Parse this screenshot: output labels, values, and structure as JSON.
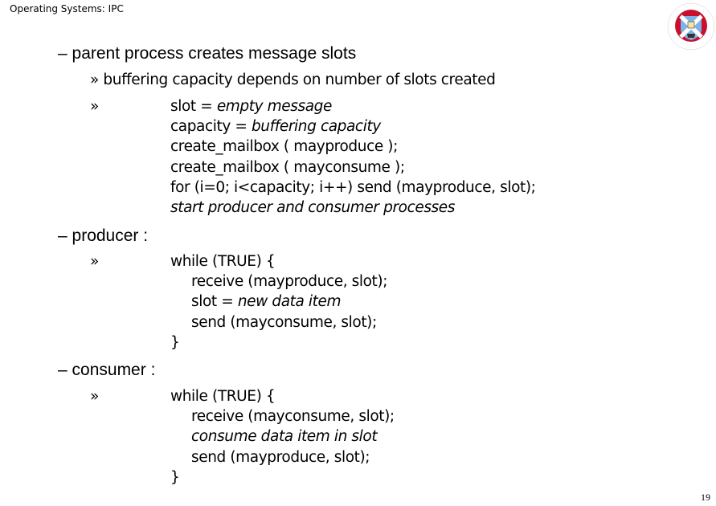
{
  "header": {
    "title": "Operating Systems: IPC"
  },
  "logo": {
    "name": "University of Edinburgh crest",
    "ring_text_top": "THE UNIVERSITY",
    "ring_text_bottom": "EDINBURGH"
  },
  "bullets": {
    "dash": "–",
    "chevron": "»"
  },
  "parent": {
    "heading": "parent process creates message slots",
    "sub1": "buffering capacity depends on number of slots created",
    "code": [
      {
        "plain": "slot = ",
        "italic": "empty message"
      },
      {
        "plain": "capacity = ",
        "italic": "buffering capacity"
      },
      {
        "plain": "create_mailbox ( mayproduce );",
        "italic": ""
      },
      {
        "plain": "create_mailbox ( mayconsume );",
        "italic": ""
      },
      {
        "plain": "for (i=0; i<capacity; i++) send (mayproduce, slot);",
        "italic": ""
      },
      {
        "plain": "",
        "italic": "start producer and consumer processes"
      }
    ]
  },
  "producer": {
    "heading": "producer :",
    "code": [
      {
        "plain": "while (TRUE) {",
        "italic": ""
      },
      {
        "plain": "receive (mayproduce, slot);",
        "italic": ""
      },
      {
        "plain": "slot = ",
        "italic": "new data item"
      },
      {
        "plain": "send (mayconsume, slot);",
        "italic": ""
      },
      {
        "plain": "}",
        "italic": ""
      }
    ]
  },
  "consumer": {
    "heading": "consumer :",
    "code": [
      {
        "plain": "while (TRUE) {",
        "italic": ""
      },
      {
        "plain": "receive (mayconsume, slot);",
        "italic": ""
      },
      {
        "plain": "",
        "italic": "consume data item in slot"
      },
      {
        "plain": "send (mayproduce, slot);",
        "italic": ""
      },
      {
        "plain": "}",
        "italic": ""
      }
    ]
  },
  "footer": {
    "page_number": "19"
  }
}
